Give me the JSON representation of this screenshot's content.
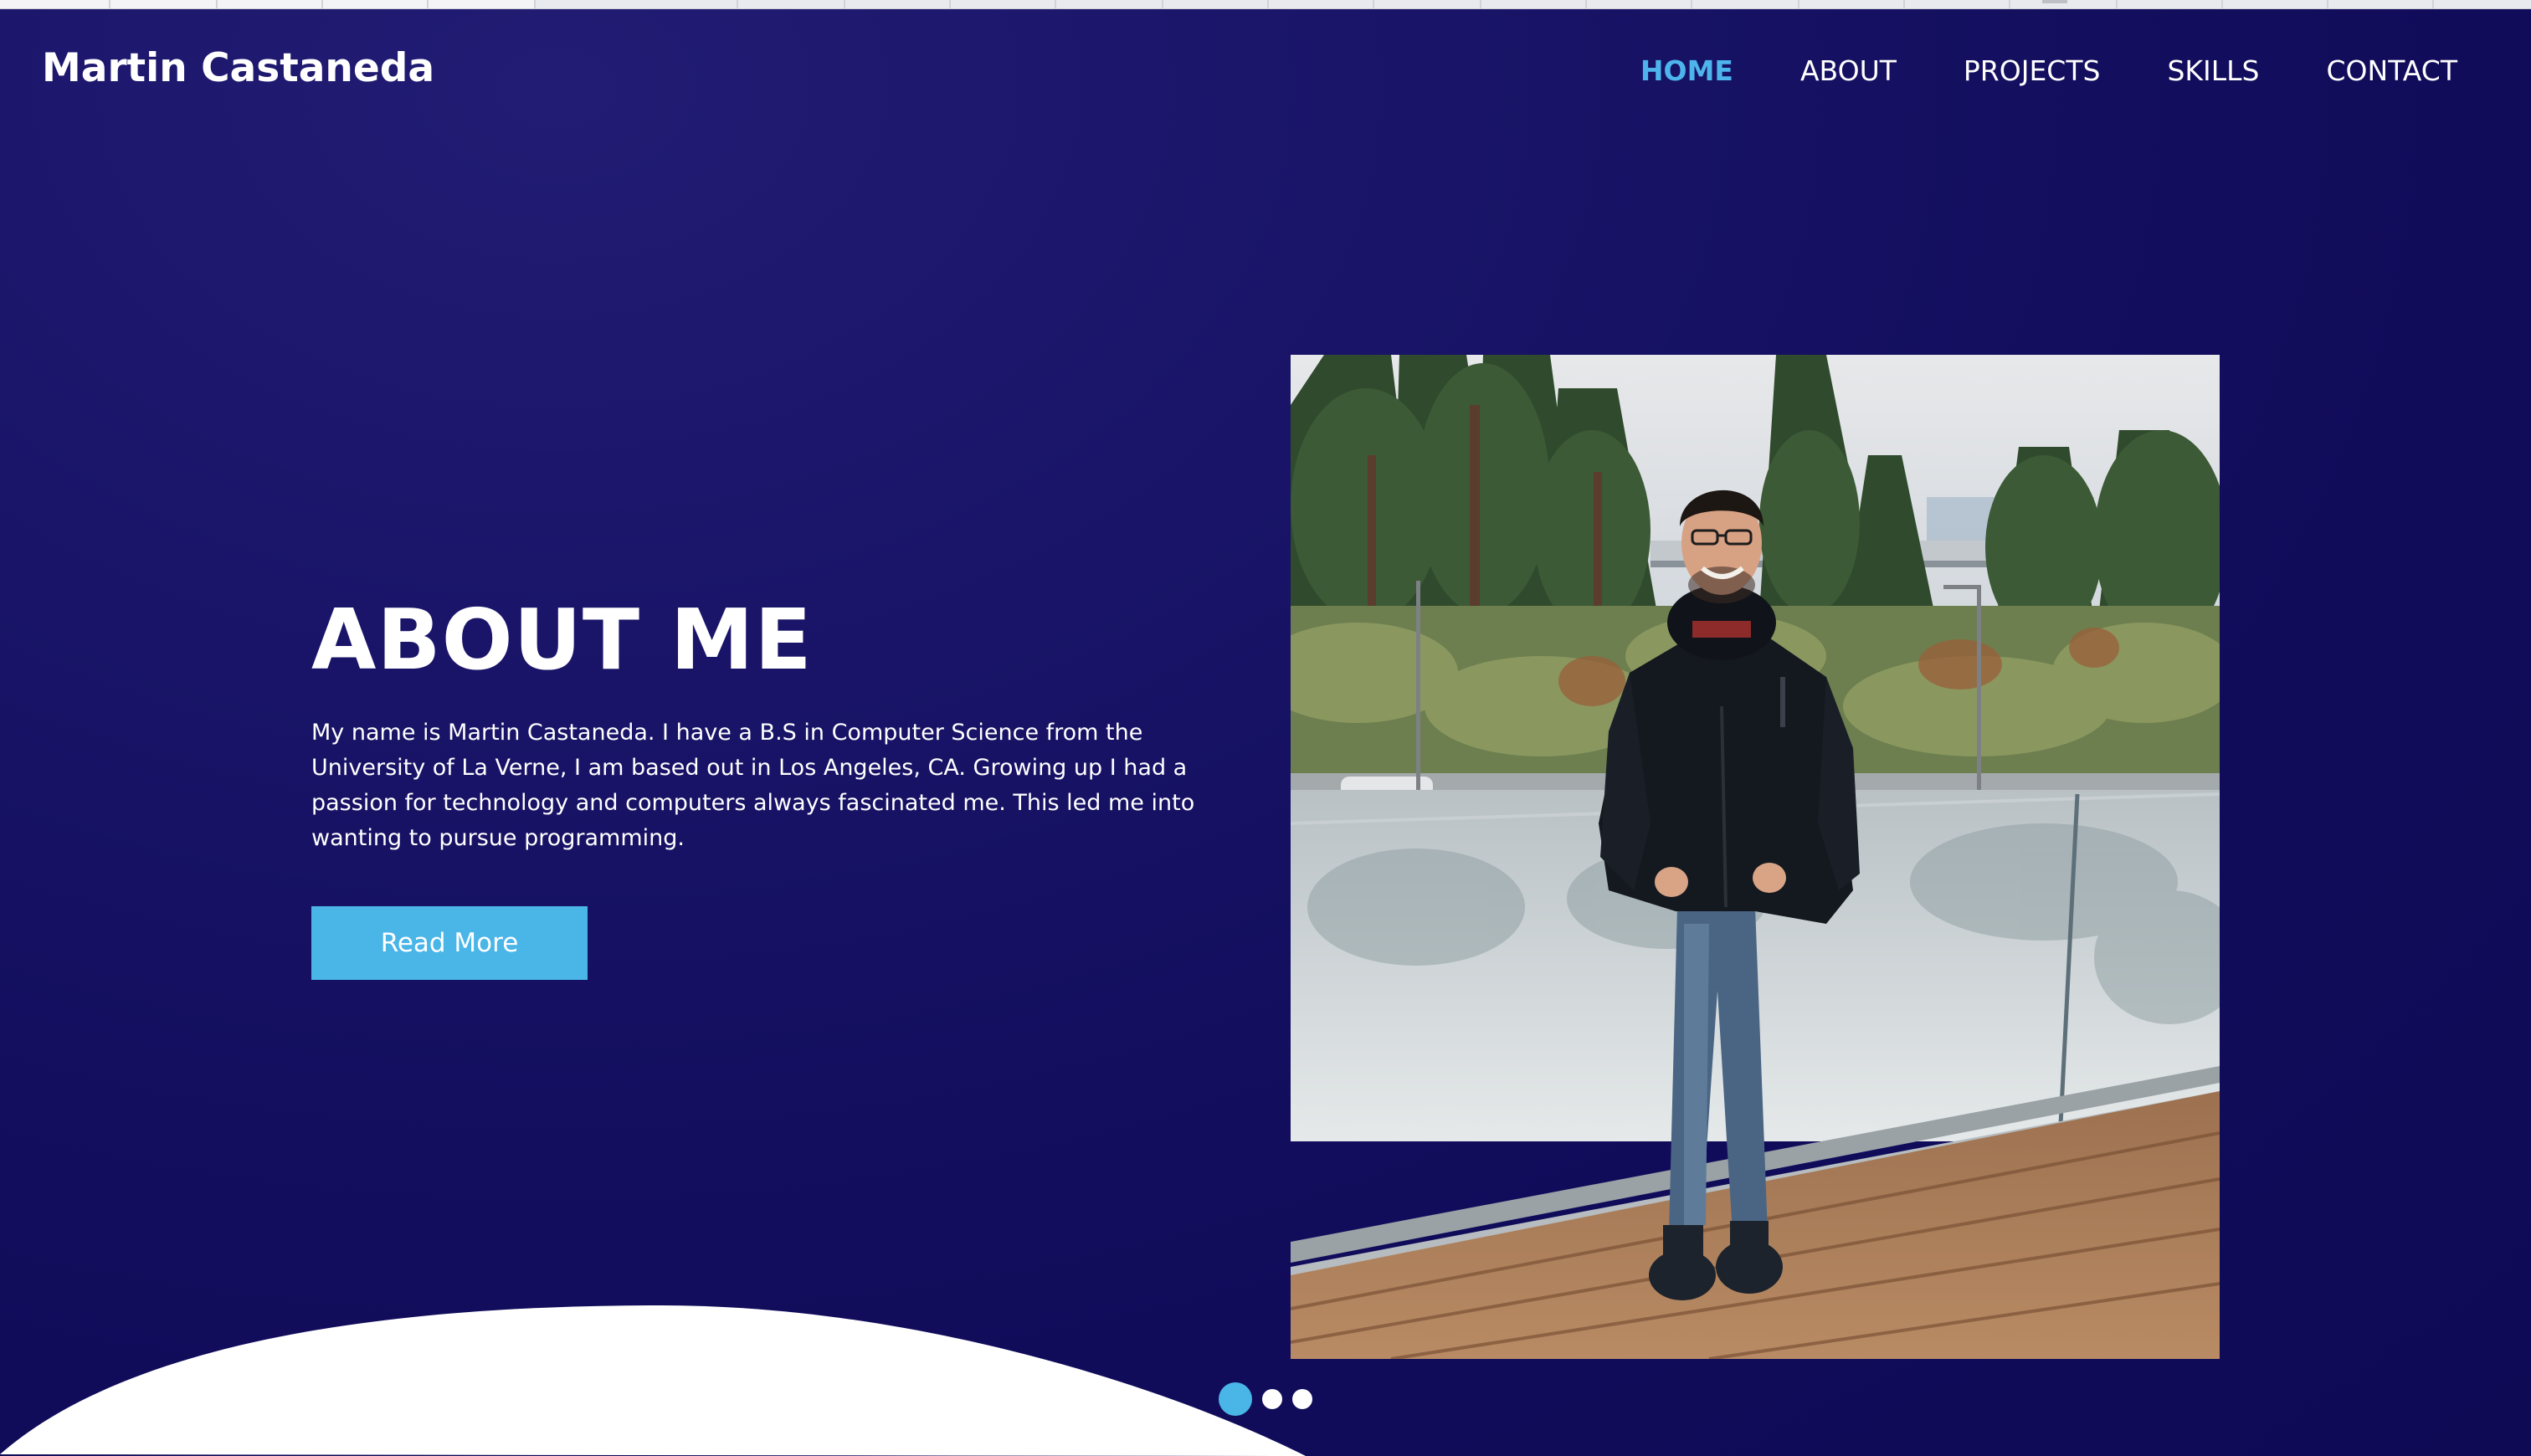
{
  "site": {
    "brand": "Martin Castaneda"
  },
  "nav": {
    "items": [
      {
        "label": "HOME",
        "active": true
      },
      {
        "label": "ABOUT",
        "active": false
      },
      {
        "label": "PROJECTS",
        "active": false
      },
      {
        "label": "SKILLS",
        "active": false
      },
      {
        "label": "CONTACT",
        "active": false
      }
    ]
  },
  "hero": {
    "title": "ABOUT ME",
    "body": "My name is Martin Castaneda. I have a B.S in Computer Science from the University of La Verne, I am based out in Los Angeles, CA. Growing up I had a passion for technology and computers always fascinated me. This led me into wanting to pursue programming.",
    "button_label": "Read More",
    "photo_icon": "portrait-photo"
  },
  "carousel": {
    "slide_count": 3,
    "active_index": 0
  },
  "colors": {
    "background": "#130e5e",
    "accent": "#4ab5e7",
    "text": "#ffffff",
    "wave": "#ffffff"
  }
}
